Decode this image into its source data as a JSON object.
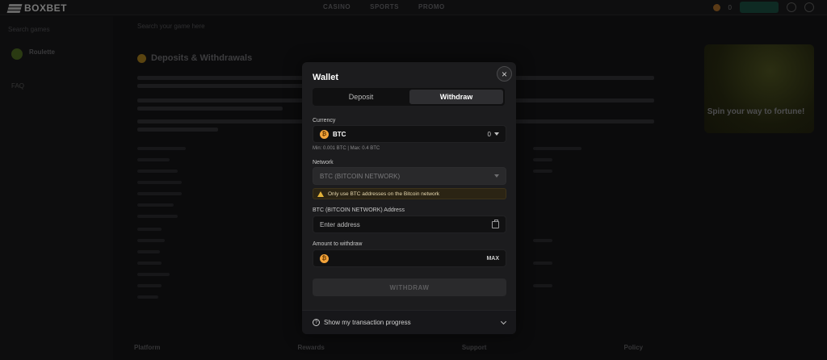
{
  "site": {
    "logo_text": "BOXBET",
    "nav": [
      "CASINO",
      "SPORTS",
      "PROMO"
    ],
    "balance": "0"
  },
  "sidebar": {
    "search_placeholder": "Search games",
    "roulette_title": "Roulette",
    "faq_label": "FAQ"
  },
  "content": {
    "search_placeholder": "Search your game here",
    "page_title": "Deposits & Withdrawals",
    "footer_cols": [
      "Platform",
      "Rewards",
      "Support",
      "Policy"
    ]
  },
  "promo": {
    "text": "Spin your way to fortune!"
  },
  "modal": {
    "title": "Wallet",
    "close_glyph": "×",
    "tabs": [
      {
        "label": "Deposit",
        "active": false
      },
      {
        "label": "Withdraw",
        "active": true
      }
    ],
    "currency": {
      "label": "Currency",
      "coin_glyph": "₿",
      "name": "BTC",
      "balance": "0",
      "limits": "Min: 0.001 BTC | Max: 0.4 BTC"
    },
    "network": {
      "label": "Network",
      "value": "BTC (BITCOIN NETWORK)"
    },
    "warning": "Only use BTC addresses on the Bitcoin network",
    "address": {
      "label": "BTC (BITCOIN NETWORK) Address",
      "placeholder": "Enter address",
      "value": ""
    },
    "amount": {
      "label": "Amount to withdraw",
      "value": "",
      "max_label": "MAX"
    },
    "submit_label": "WITHDRAW",
    "progress_label": "Show my transaction progress",
    "help_glyph": "?"
  },
  "colors": {
    "modal_bg": "#1c1c1e",
    "btc_orange": "#f2a33a",
    "warning_yellow": "#e2b23a"
  }
}
